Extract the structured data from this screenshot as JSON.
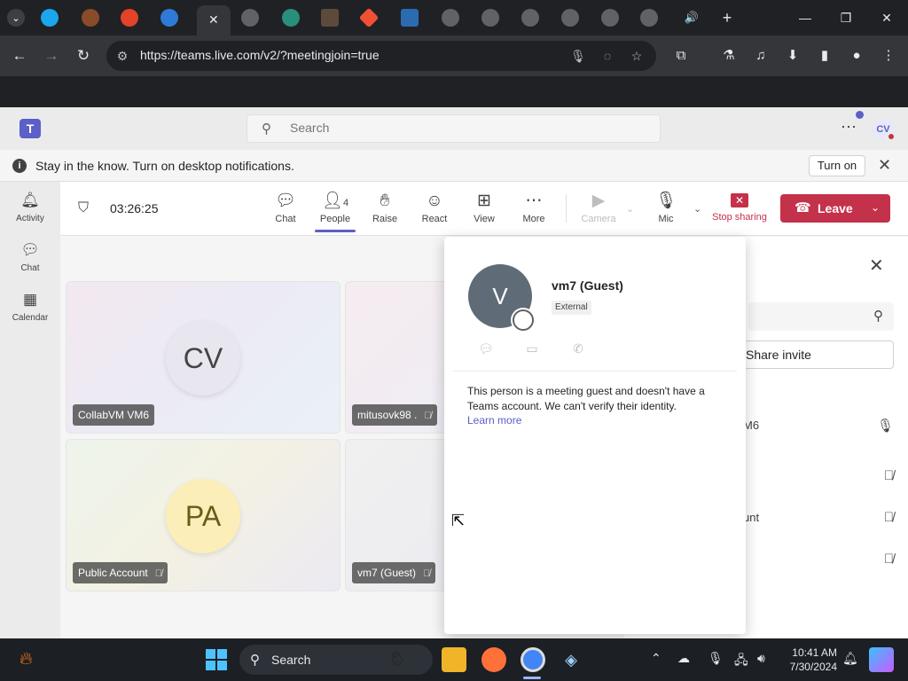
{
  "browser": {
    "url": "https://teams.live.com/v2/?meetingjoin=true",
    "tab_icons": [
      "teams-icon",
      "profile-icon",
      "gitlab-icon",
      "pinwheel-icon",
      "close-tab-icon",
      "globe-icon",
      "vm-icon",
      "file-icon",
      "git-icon",
      "image-icon",
      "globe-icon",
      "globe-icon",
      "globe-icon",
      "globe-icon",
      "globe-icon",
      "globe-icon",
      "audio-icon"
    ]
  },
  "teams": {
    "search_placeholder": "Search",
    "me_initials": "CV",
    "notification": {
      "text": "Stay in the know. Turn on desktop notifications.",
      "button": "Turn on"
    },
    "rail": [
      {
        "label": "Activity",
        "icon": "bell-icon"
      },
      {
        "label": "Chat",
        "icon": "chat-icon"
      },
      {
        "label": "Calendar",
        "icon": "calendar-icon"
      }
    ]
  },
  "meeting": {
    "timer": "03:26:25",
    "controls": {
      "chat": "Chat",
      "people": "People",
      "people_count": "4",
      "raise": "Raise",
      "react": "React",
      "view": "View",
      "more": "More",
      "camera": "Camera",
      "mic": "Mic",
      "stop_sharing": "Stop sharing",
      "leave": "Leave"
    },
    "tiles": [
      {
        "initials": "CV",
        "name": "CollabVM VM6"
      },
      {
        "initials": "",
        "name": "mitusovk98 ."
      },
      {
        "initials": "PA",
        "name": "Public Account"
      },
      {
        "initials": "",
        "name": "vm7 (Guest)"
      }
    ]
  },
  "people_panel": {
    "share_invite": "Share invite",
    "rows": [
      "M6",
      ".",
      "unt",
      ":"
    ]
  },
  "popover": {
    "initial": "V",
    "name": "vm7 (Guest)",
    "badge": "External",
    "message": "This person is a meeting guest and doesn't have a Teams account. We can't verify their identity.",
    "learn_more": "Learn more"
  },
  "taskbar": {
    "search": "Search",
    "time": "10:41 AM",
    "date": "7/30/2024"
  },
  "colors": {
    "teams_brand": "#5b5fc7",
    "leave_red": "#c4314b",
    "taskbar_bg": "#1c1f24"
  }
}
